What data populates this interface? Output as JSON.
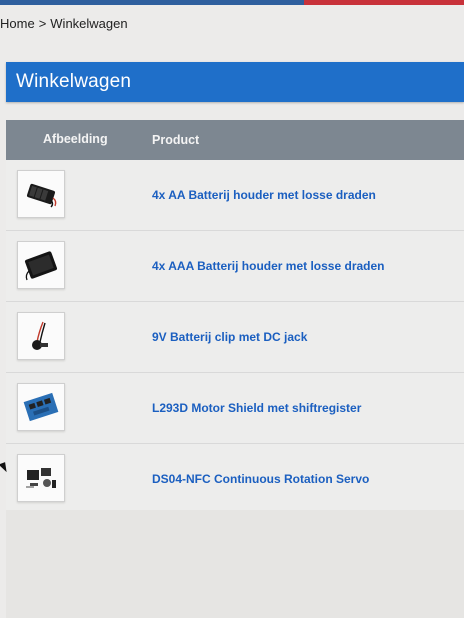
{
  "breadcrumb": {
    "home": "Home",
    "separator": ">",
    "current": "Winkelwagen"
  },
  "page": {
    "title": "Winkelwagen"
  },
  "table": {
    "headers": {
      "image": "Afbeelding",
      "product": "Product"
    },
    "rows": [
      {
        "product": "4x AA Batterij houder met losse draden",
        "icon": "battery-holder-aa-icon"
      },
      {
        "product": "4x AAA Batterij houder met losse draden",
        "icon": "battery-holder-aaa-icon"
      },
      {
        "product": "9V Batterij clip met DC jack",
        "icon": "battery-clip-icon"
      },
      {
        "product": "L293D Motor Shield met shiftregister",
        "icon": "motor-shield-icon"
      },
      {
        "product": "DS04-NFC Continuous Rotation Servo",
        "icon": "servo-icon"
      }
    ]
  },
  "colors": {
    "header": "#1f6fc9",
    "table_head": "#7d8791",
    "link": "#1b5fc0"
  }
}
